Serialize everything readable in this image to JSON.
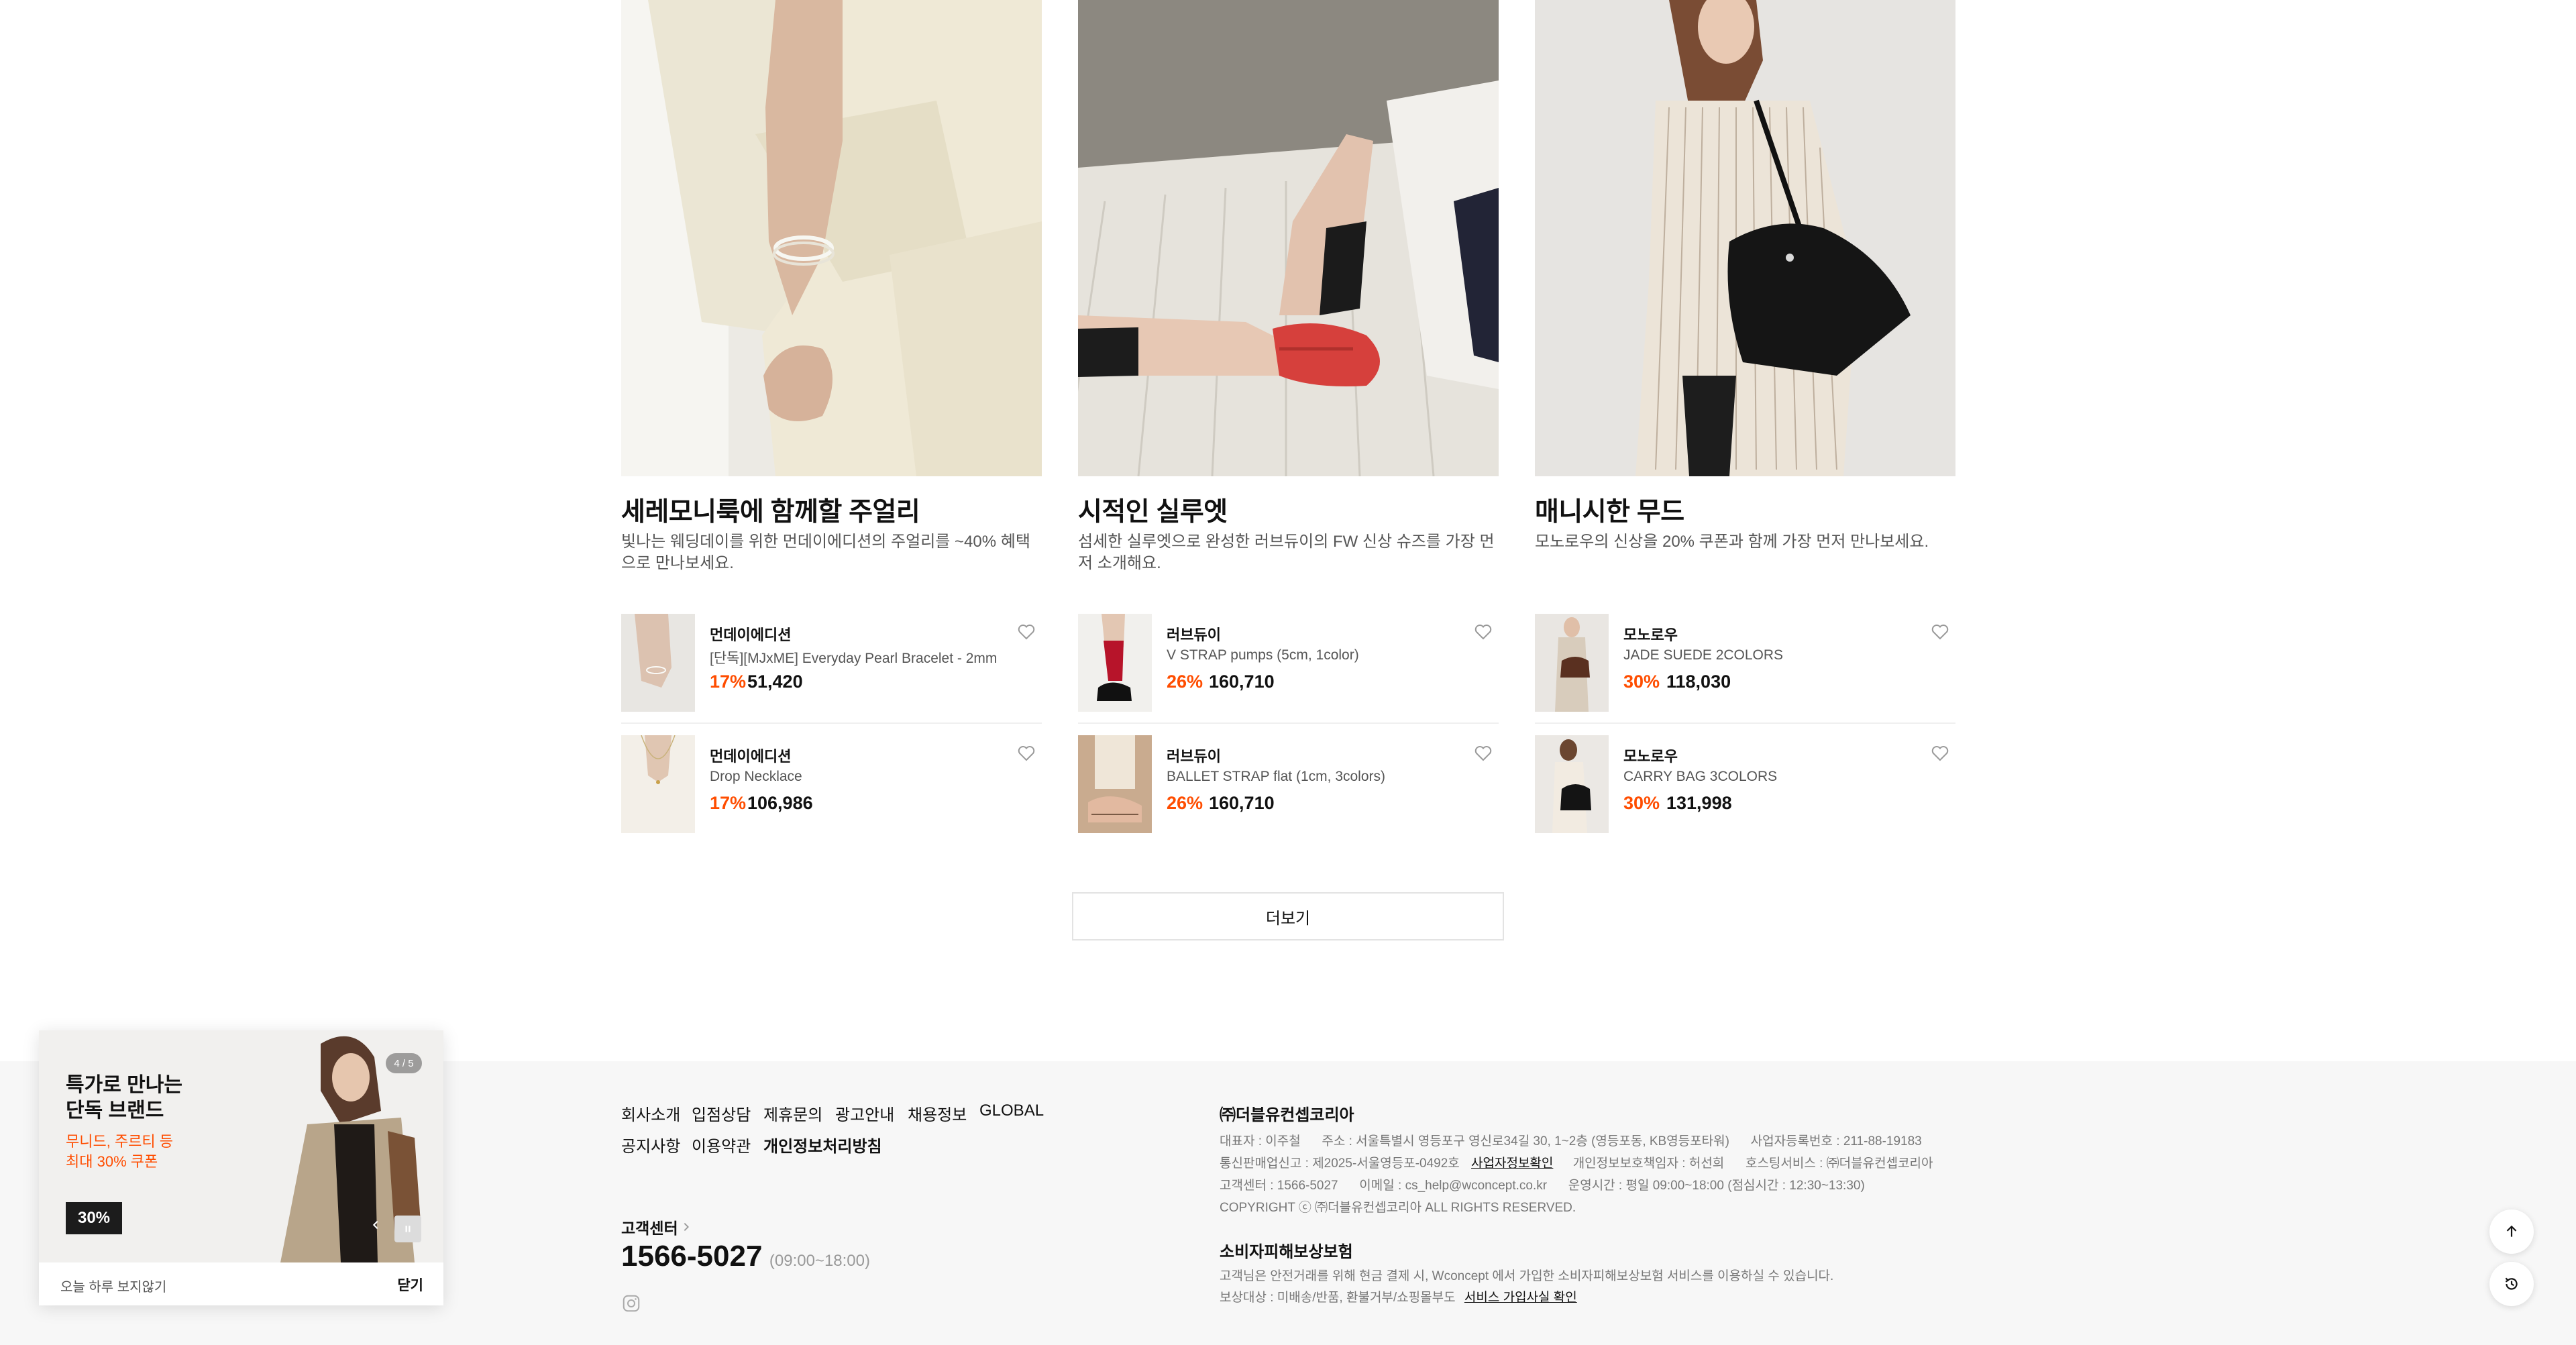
{
  "sections": [
    {
      "title": "세레모니룩에 함께할 주얼리",
      "desc": "빛나는 웨딩데이를 위한 먼데이에디션의 주얼리를 ~40% 혜택으로 만나보세요.",
      "products": [
        {
          "brand": "먼데이에디션",
          "name": "[단독][MJxME] Everyday Pearl Bracelet - 2mm",
          "discount": "17%",
          "price": "51,420"
        },
        {
          "brand": "먼데이에디션",
          "name": "Drop Necklace",
          "discount": "17%",
          "price": "106,986"
        }
      ]
    },
    {
      "title": "시적인 실루엣",
      "desc": "섬세한 실루엣으로 완성한 러브듀이의 FW 신상 슈즈를 가장 먼저 소개해요.",
      "products": [
        {
          "brand": "러브듀이",
          "name": "V STRAP pumps (5cm, 1color)",
          "discount": "26%",
          "price": "160,710"
        },
        {
          "brand": "러브듀이",
          "name": "BALLET STRAP flat (1cm, 3colors)",
          "discount": "26%",
          "price": "160,710"
        }
      ]
    },
    {
      "title": "매니시한 무드",
      "desc": "모노로우의 신상을 20% 쿠폰과 함께 가장 먼저 만나보세요.",
      "products": [
        {
          "brand": "모노로우",
          "name": "JADE SUEDE 2COLORS",
          "discount": "30%",
          "price": "118,030"
        },
        {
          "brand": "모노로우",
          "name": "CARRY BAG 3COLORS",
          "discount": "30%",
          "price": "131,998"
        }
      ]
    }
  ],
  "more_button": "더보기",
  "footer": {
    "links_row1": [
      "회사소개",
      "입점상담",
      "제휴문의",
      "광고안내",
      "채용정보",
      "GLOBAL"
    ],
    "links_row2": [
      "공지사항",
      "이용약관",
      "개인정보처리방침"
    ],
    "cs_label": "고객센터",
    "cs_phone": "1566-5027",
    "cs_hours": "(09:00~18:00)",
    "company_name": "㈜더블유컨셉코리아",
    "info_line1": "대표자 : 이주철      주소 : 서울특별시 영등포구 영신로34길 30, 1~2층 (영등포동, KB영등포타워)      사업자등록번호 : 211-88-19183",
    "info_line2_a": "통신판매업신고 : 제2025-서울영등포-0492호",
    "info_line2_link": "사업자정보확인",
    "info_line2_b": "개인정보보호책임자 : 허선희      호스팅서비스 : ㈜더블유컨셉코리아",
    "info_line3": "고객센터 : 1566-5027      이메일 : cs_help@wconcept.co.kr      운영시간 : 평일 09:00~18:00 (점심시간 : 12:30~13:30)",
    "info_line4": "COPYRIGHT ⓒ ㈜더블유컨셉코리아 ALL RIGHTS RESERVED.",
    "insurance_title": "소비자피해보상보험",
    "insurance_line1": "고객님은 안전거래를 위해 현금 결제 시, Wconcept 에서 가입한 소비자피해보상보험 서비스를 이용하실 수 있습니다.",
    "insurance_line2": "보상대상 : 미배송/반품, 환불거부/쇼핑몰부도",
    "insurance_link": "서비스 가입사실 확인"
  },
  "popup": {
    "line1": "특가로 만나는",
    "line2": "단독 브랜드",
    "sub1": "무니드, 주르티 등",
    "sub2": "최대 30% 쿠폰",
    "badge": "30%",
    "counter": "4 / 5",
    "dismiss_today": "오늘 하루 보지않기",
    "close": "닫기"
  },
  "colors": {
    "discount": "#ff4d00",
    "footer_bg": "#f7f7f7",
    "popup_accent": "#ff4d00"
  },
  "icons": [
    "heart-icon",
    "chevron-right-icon",
    "instagram-icon",
    "arrow-up-icon",
    "history-icon",
    "pause-icon",
    "chevron-left-icon"
  ]
}
